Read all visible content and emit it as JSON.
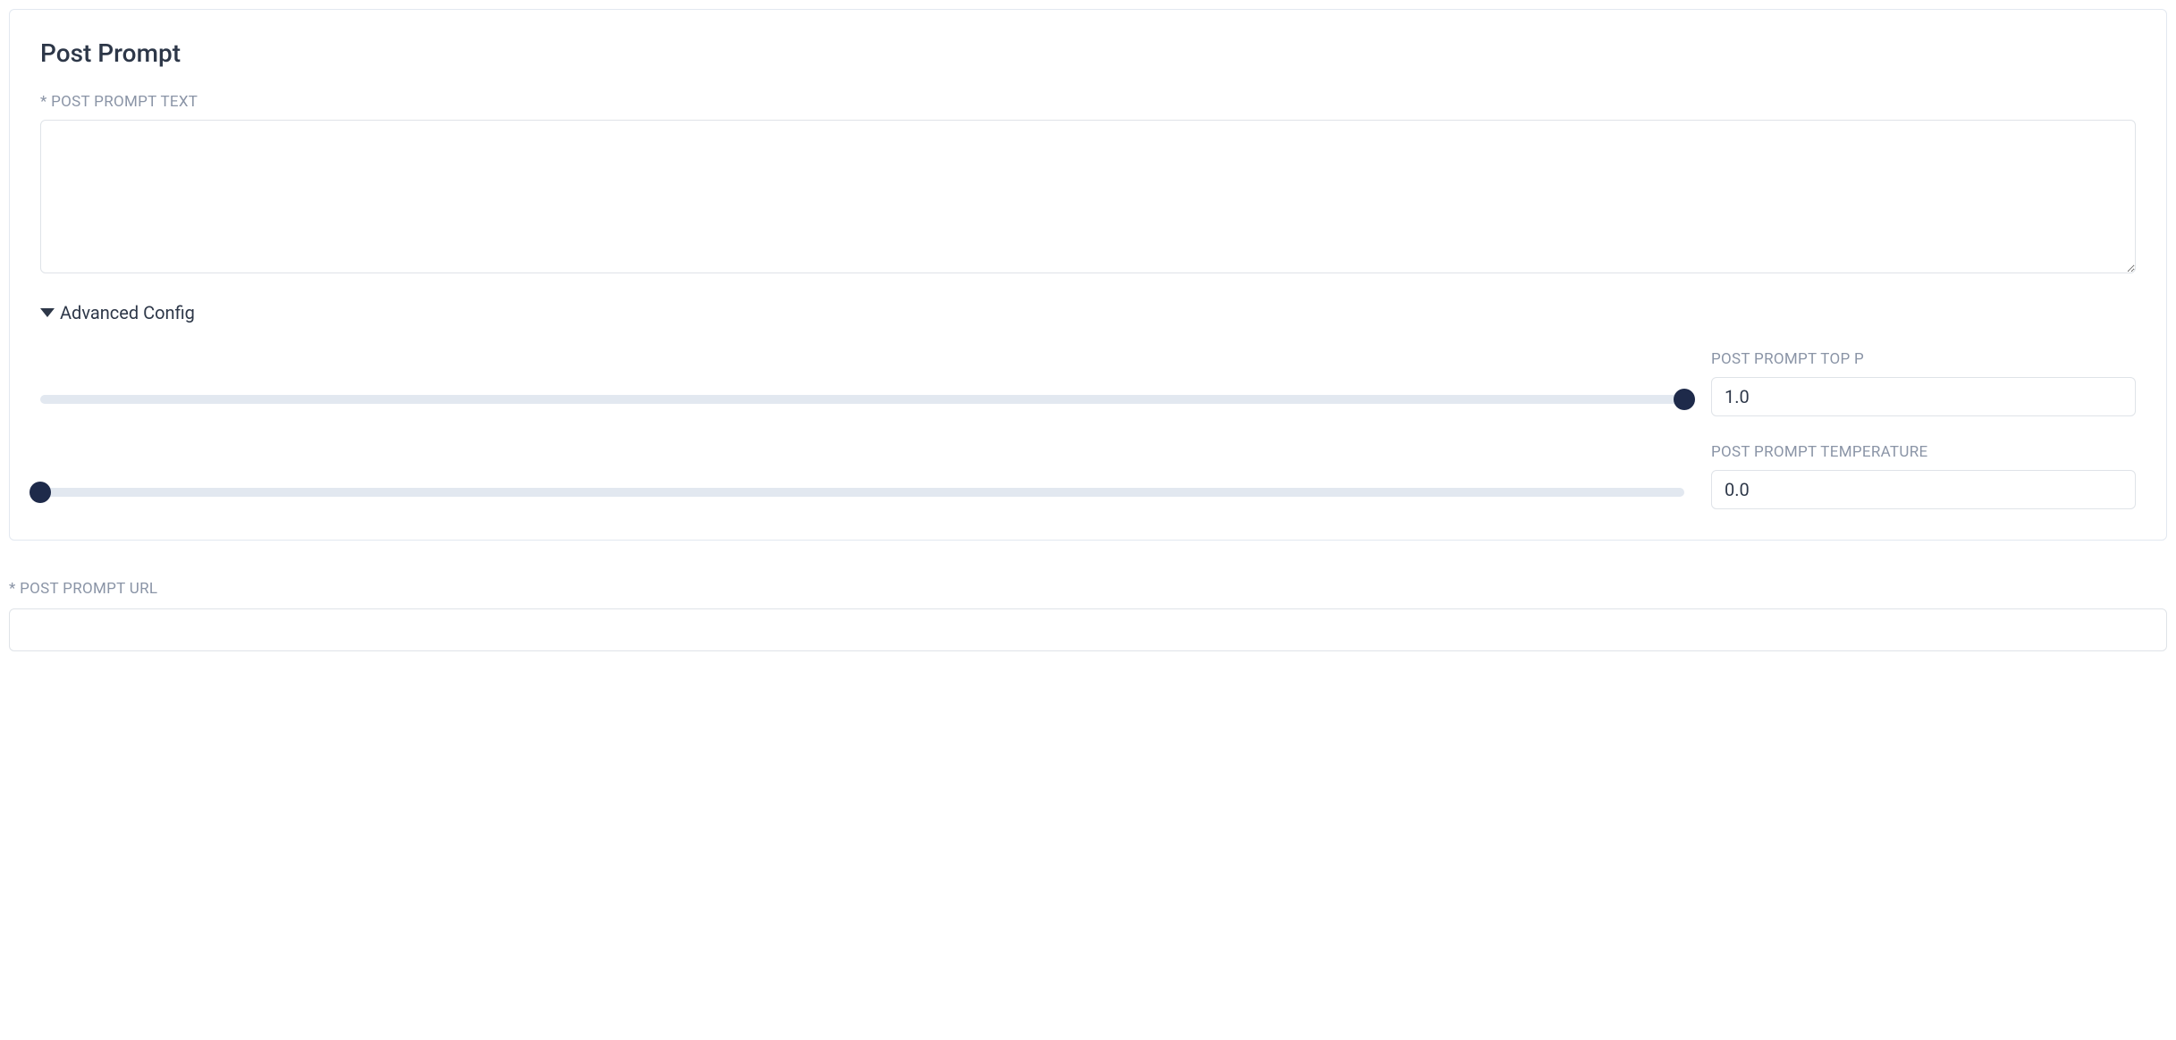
{
  "card": {
    "title": "Post Prompt",
    "text_label": "* POST PROMPT TEXT",
    "text_value": "",
    "advanced_label": "Advanced Config",
    "top_p": {
      "label": "POST PROMPT TOP P",
      "value": "1.0",
      "slider_percent": 100
    },
    "temperature": {
      "label": "POST PROMPT TEMPERATURE",
      "value": "0.0",
      "slider_percent": 0
    }
  },
  "url_field": {
    "label": "* POST PROMPT URL",
    "value": ""
  }
}
